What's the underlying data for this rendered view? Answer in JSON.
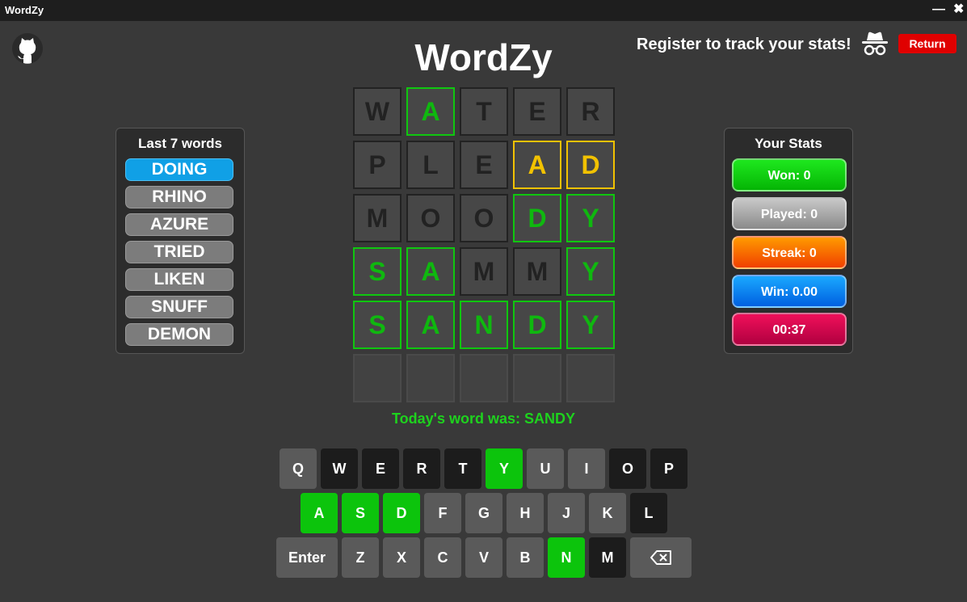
{
  "window": {
    "title": "WordZy",
    "minimize": "—",
    "close": "✖"
  },
  "header": {
    "title": "WordZy",
    "register_text": "Register to track your stats!",
    "return_label": "Return"
  },
  "last_words": {
    "title": "Last 7 words",
    "items": [
      {
        "label": "DOING",
        "active": true
      },
      {
        "label": "RHINO",
        "active": false
      },
      {
        "label": "AZURE",
        "active": false
      },
      {
        "label": "TRIED",
        "active": false
      },
      {
        "label": "LIKEN",
        "active": false
      },
      {
        "label": "SNUFF",
        "active": false
      },
      {
        "label": "DEMON",
        "active": false
      }
    ]
  },
  "stats": {
    "title": "Your Stats",
    "won": "Won: 0",
    "played": "Played: 0",
    "streak": "Streak: 0",
    "win": "Win: 0.00",
    "timer": "00:37"
  },
  "board": {
    "rows": [
      [
        {
          "l": "W",
          "s": "x"
        },
        {
          "l": "A",
          "s": "g"
        },
        {
          "l": "T",
          "s": "x"
        },
        {
          "l": "E",
          "s": "x"
        },
        {
          "l": "R",
          "s": "x"
        }
      ],
      [
        {
          "l": "P",
          "s": "x"
        },
        {
          "l": "L",
          "s": "x"
        },
        {
          "l": "E",
          "s": "x"
        },
        {
          "l": "A",
          "s": "y"
        },
        {
          "l": "D",
          "s": "y"
        }
      ],
      [
        {
          "l": "M",
          "s": "x"
        },
        {
          "l": "O",
          "s": "x"
        },
        {
          "l": "O",
          "s": "x"
        },
        {
          "l": "D",
          "s": "g"
        },
        {
          "l": "Y",
          "s": "g"
        }
      ],
      [
        {
          "l": "S",
          "s": "g"
        },
        {
          "l": "A",
          "s": "g"
        },
        {
          "l": "M",
          "s": "x"
        },
        {
          "l": "M",
          "s": "x"
        },
        {
          "l": "Y",
          "s": "g"
        }
      ],
      [
        {
          "l": "S",
          "s": "g"
        },
        {
          "l": "A",
          "s": "g"
        },
        {
          "l": "N",
          "s": "g"
        },
        {
          "l": "D",
          "s": "g"
        },
        {
          "l": "Y",
          "s": "g"
        }
      ],
      [
        {
          "l": "",
          "s": "e"
        },
        {
          "l": "",
          "s": "e"
        },
        {
          "l": "",
          "s": "e"
        },
        {
          "l": "",
          "s": "e"
        },
        {
          "l": "",
          "s": "e"
        }
      ]
    ]
  },
  "result": {
    "text": "Today's word was: SANDY"
  },
  "keyboard": {
    "rows": [
      [
        {
          "k": "Q",
          "s": "n"
        },
        {
          "k": "W",
          "s": "d"
        },
        {
          "k": "E",
          "s": "d"
        },
        {
          "k": "R",
          "s": "d"
        },
        {
          "k": "T",
          "s": "d"
        },
        {
          "k": "Y",
          "s": "g"
        },
        {
          "k": "U",
          "s": "n"
        },
        {
          "k": "I",
          "s": "n"
        },
        {
          "k": "O",
          "s": "d"
        },
        {
          "k": "P",
          "s": "d"
        }
      ],
      [
        {
          "k": "A",
          "s": "g"
        },
        {
          "k": "S",
          "s": "g"
        },
        {
          "k": "D",
          "s": "g"
        },
        {
          "k": "F",
          "s": "n"
        },
        {
          "k": "G",
          "s": "n"
        },
        {
          "k": "H",
          "s": "n"
        },
        {
          "k": "J",
          "s": "n"
        },
        {
          "k": "K",
          "s": "n"
        },
        {
          "k": "L",
          "s": "d"
        }
      ],
      [
        {
          "k": "Enter",
          "s": "n"
        },
        {
          "k": "Z",
          "s": "n"
        },
        {
          "k": "X",
          "s": "n"
        },
        {
          "k": "C",
          "s": "n"
        },
        {
          "k": "V",
          "s": "n"
        },
        {
          "k": "B",
          "s": "n"
        },
        {
          "k": "N",
          "s": "g"
        },
        {
          "k": "M",
          "s": "d"
        },
        {
          "k": "",
          "s": "n",
          "icon": "backspace-icon"
        }
      ]
    ]
  },
  "colors": {
    "green": "#0cc40c",
    "yellow": "#f2c200",
    "accent_blue": "#10a0e6",
    "return_red": "#e00000"
  }
}
